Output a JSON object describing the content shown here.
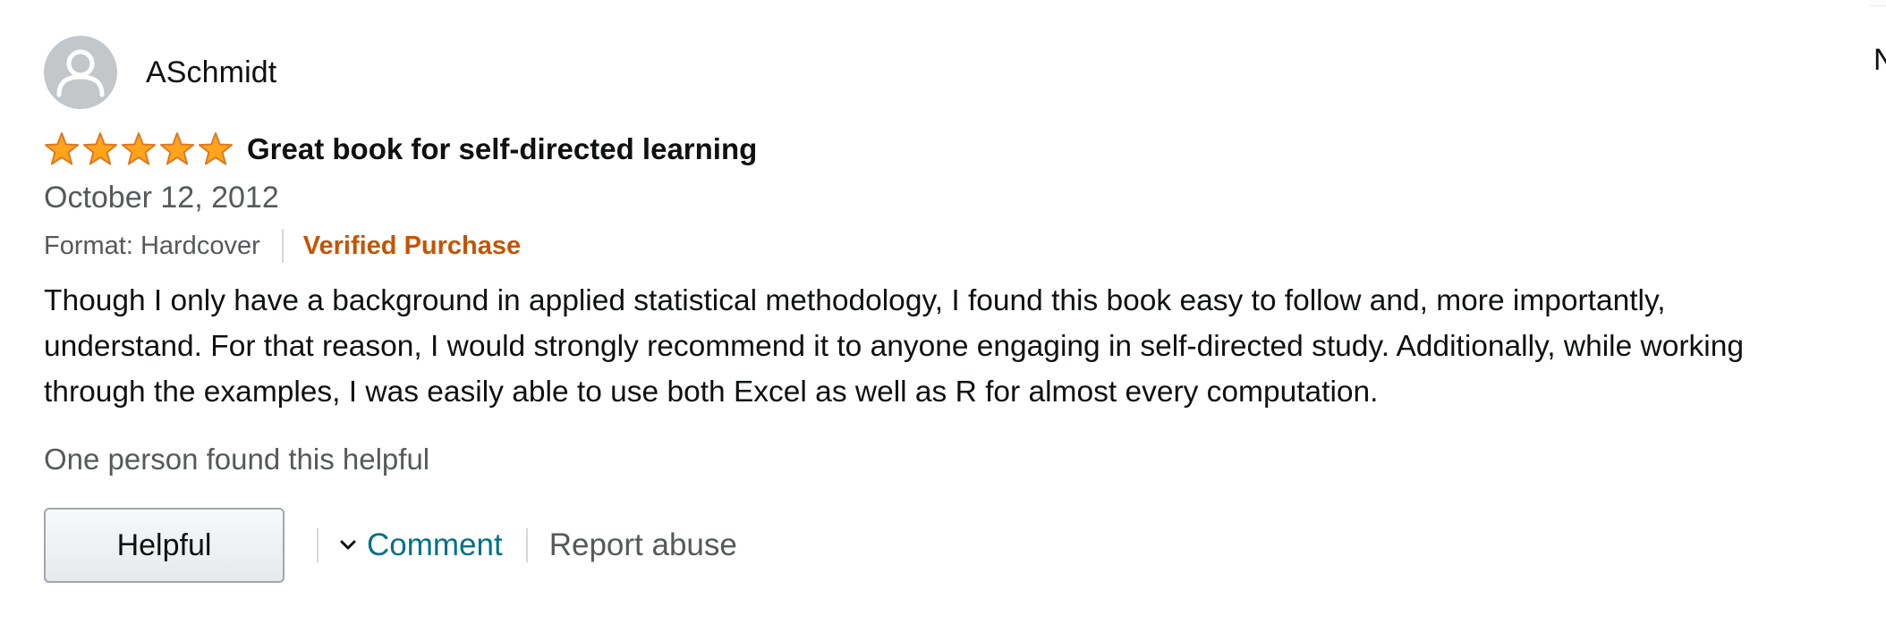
{
  "review": {
    "profile_name": "ASchmidt",
    "rating": 5,
    "rating_max": 5,
    "title": "Great book for self-directed learning",
    "date": "October 12, 2012",
    "format": "Format: Hardcover",
    "verified": "Verified Purchase",
    "body": "Though I only have a background in applied statistical methodology, I found this book easy to follow and, more importantly, understand. For that reason, I would strongly recommend it to anyone engaging in self-directed study. Additionally, while working through the examples, I was easily able to use both Excel as well as R for almost every computation.",
    "helpful_count": "One person found this helpful"
  },
  "actions": {
    "helpful_label": "Helpful",
    "comment_label": "Comment",
    "report_label": "Report abuse"
  },
  "edge": {
    "partial_text": "N"
  },
  "icons": {
    "avatar": "person-icon",
    "star": "star-icon",
    "comment": "chevron-down-icon"
  },
  "colors": {
    "star_fill": "#ffa41c",
    "star_stroke": "#de7921",
    "verified": "#c45500",
    "link": "#007185",
    "muted": "#565959",
    "avatar_bg": "#c3c7ca"
  }
}
